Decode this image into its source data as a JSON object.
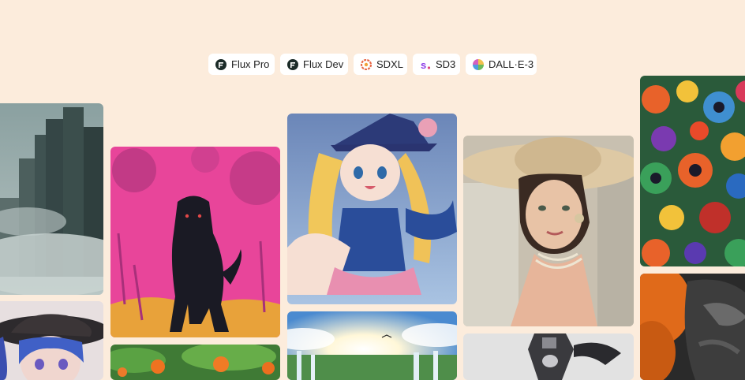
{
  "models": [
    {
      "label": "Flux Pro",
      "icon": "flux-logo-icon"
    },
    {
      "label": "Flux Dev",
      "icon": "flux-logo-icon"
    },
    {
      "label": "SDXL",
      "icon": "sdxl-logo-icon"
    },
    {
      "label": "SD3",
      "icon": "sd3-logo-icon"
    },
    {
      "label": "DALL·E-3",
      "icon": "dalle-logo-icon"
    }
  ],
  "gallery": [
    {
      "subject": "foggy-castle-tower"
    },
    {
      "subject": "anime-girl-blue-hair-witch-hat"
    },
    {
      "subject": "black-panther-pink-jungle"
    },
    {
      "subject": "orange-flowers-foliage"
    },
    {
      "subject": "anime-magician-girl-blue-hat"
    },
    {
      "subject": "waterfalls-sunlight-landscape"
    },
    {
      "subject": "vintage-woman-straw-hat"
    },
    {
      "subject": "chrome-robot-figure"
    },
    {
      "subject": "psychedelic-kaleidoscope-pattern"
    },
    {
      "subject": "dark-figure-orange-smoke"
    }
  ]
}
